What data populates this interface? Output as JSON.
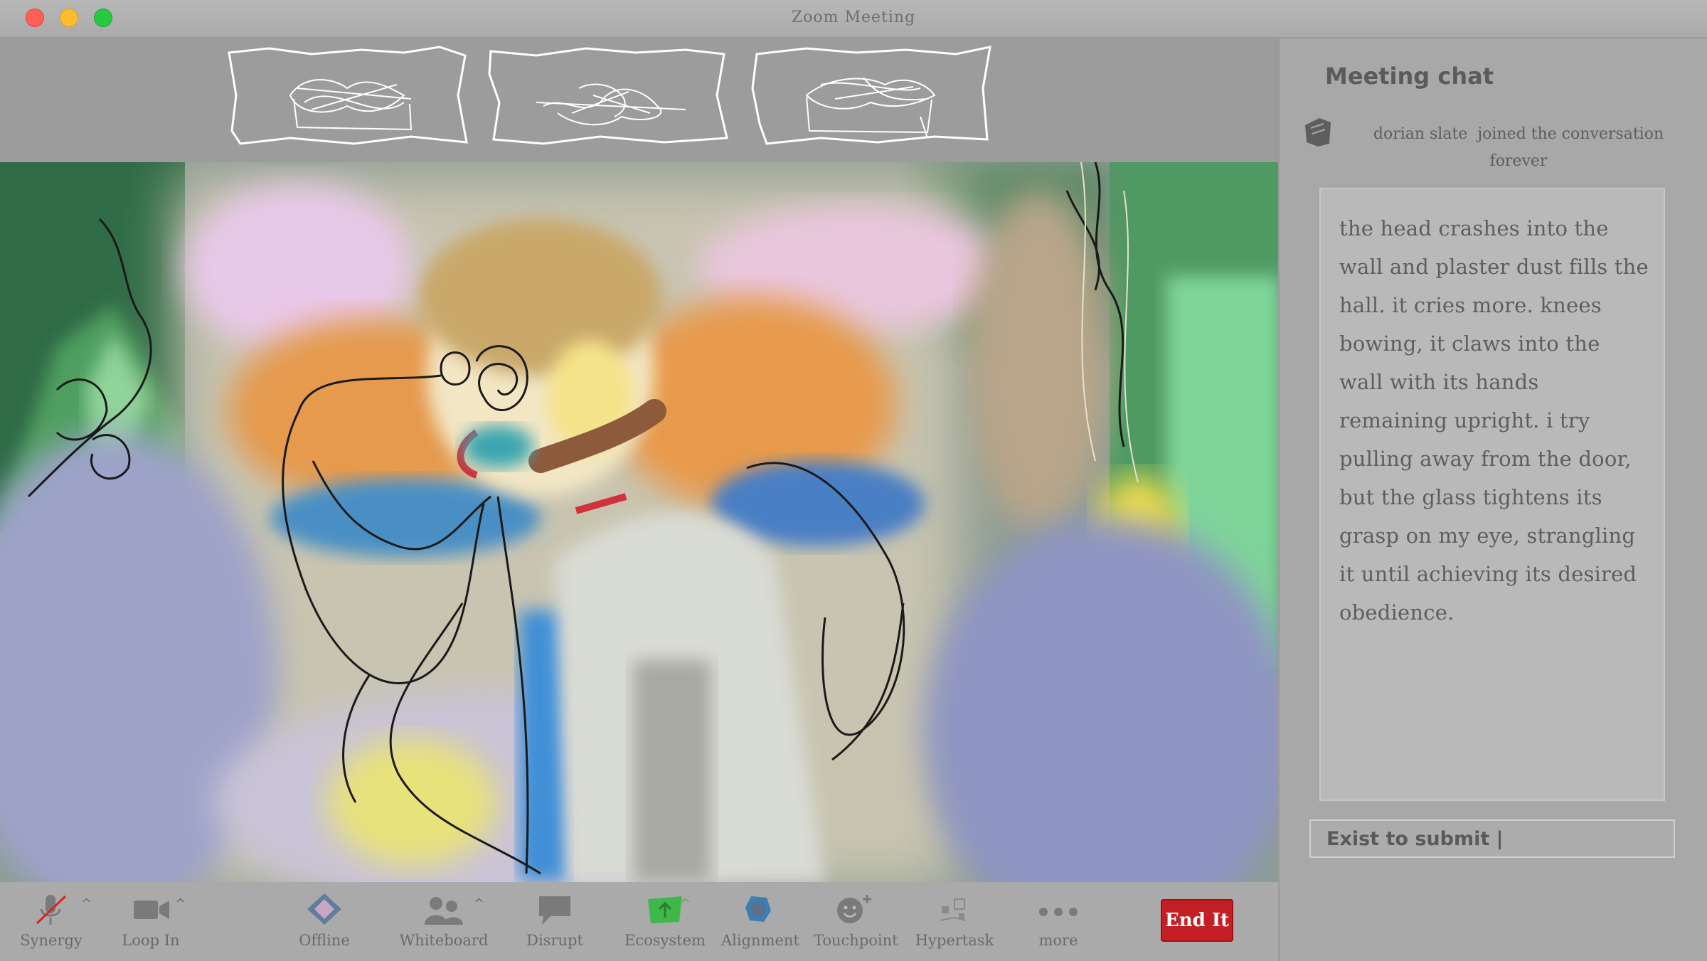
{
  "window": {
    "title": "Zoom Meeting"
  },
  "chat": {
    "title": "Meeting chat",
    "join_user": "dorian slate",
    "join_text": "joined the conversation forever",
    "message": "the head crashes into the wall and plaster dust fills the hall. it cries more. knees bowing, it claws into the wall with its hands remaining upright. i try pulling away from the door, but the glass tightens its grasp on my eye, strangling it until achieving its desired obedience.",
    "input_value": "Exist to submit |"
  },
  "toolbar": {
    "items": [
      {
        "label": "Synergy",
        "icon": "microphone-muted-icon"
      },
      {
        "label": "Loop In",
        "icon": "video-camera-icon"
      },
      {
        "label": "Offline",
        "icon": "diamond-icon"
      },
      {
        "label": "Whiteboard",
        "icon": "participants-icon"
      },
      {
        "label": "Disrupt",
        "icon": "chat-bubble-icon"
      },
      {
        "label": "Ecosystem",
        "icon": "share-screen-icon"
      },
      {
        "label": "Alignment",
        "icon": "record-icon"
      },
      {
        "label": "Touchpoint",
        "icon": "reactions-icon"
      },
      {
        "label": "Hypertask",
        "icon": "apps-icon"
      },
      {
        "label": "more",
        "icon": "more-icon"
      }
    ],
    "end_label": "End It"
  },
  "colors": {
    "end_button": "#c41f24",
    "share_green": "#3fb84a",
    "alignment_blue": "#3b7fb3",
    "window_gray": "#a6a6a6"
  }
}
